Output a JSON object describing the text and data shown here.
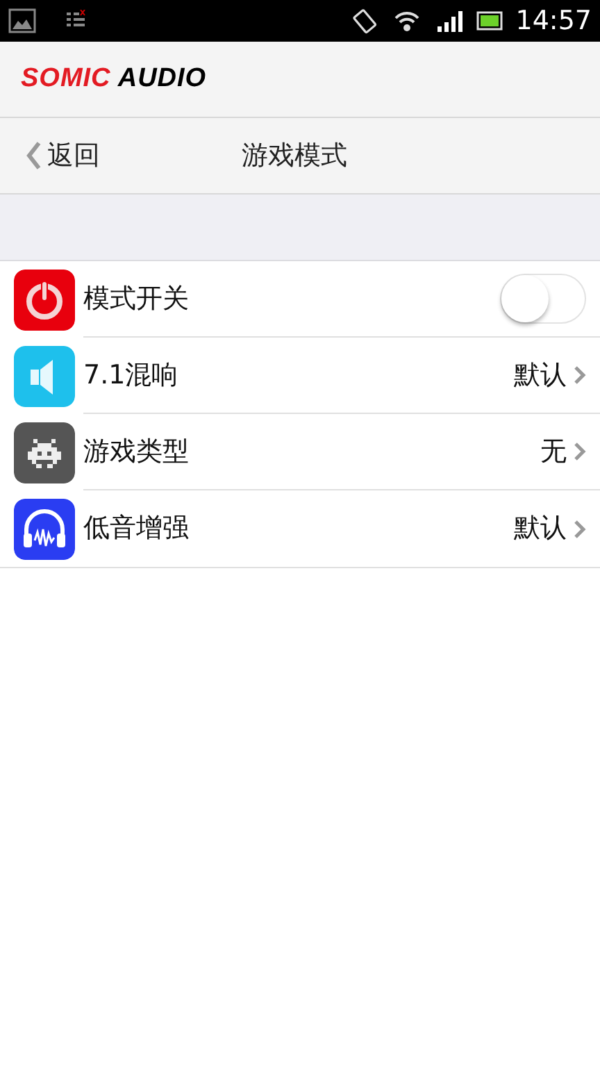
{
  "status_bar": {
    "time": "14:57"
  },
  "logo": {
    "brand": "SOMIC",
    "product": "AUDIO"
  },
  "nav": {
    "back": "返回",
    "title": "游戏模式"
  },
  "rows": [
    {
      "kind": "toggle",
      "label": "模式开关",
      "on": false
    },
    {
      "kind": "link",
      "label": "7.1混响",
      "value": "默认"
    },
    {
      "kind": "link",
      "label": "游戏类型",
      "value": "无"
    },
    {
      "kind": "link",
      "label": "低音增强",
      "value": "默认"
    }
  ]
}
